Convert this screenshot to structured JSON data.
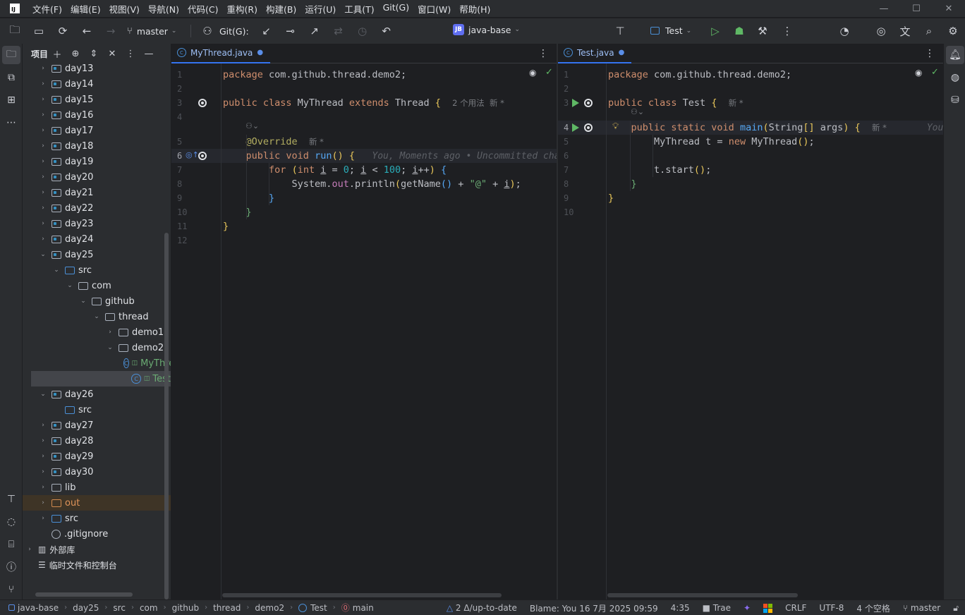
{
  "app": {
    "menu": [
      "文件(F)",
      "编辑(E)",
      "视图(V)",
      "导航(N)",
      "代码(C)",
      "重构(R)",
      "构建(B)",
      "运行(U)",
      "工具(T)",
      "Git(G)",
      "窗口(W)",
      "帮助(H)"
    ],
    "logo_text": "IJ"
  },
  "toolbar": {
    "branch": "master",
    "git_label": "Git(G):",
    "project_badge": "JB",
    "project_name": "java-base",
    "run_config": "Test"
  },
  "project_panel": {
    "title": "项目",
    "tree": [
      {
        "label": "day13",
        "level": 1,
        "kind": "module",
        "expanded": false
      },
      {
        "label": "day14",
        "level": 1,
        "kind": "module",
        "expanded": false
      },
      {
        "label": "day15",
        "level": 1,
        "kind": "module",
        "expanded": false
      },
      {
        "label": "day16",
        "level": 1,
        "kind": "module",
        "expanded": false
      },
      {
        "label": "day17",
        "level": 1,
        "kind": "module",
        "expanded": false
      },
      {
        "label": "day18",
        "level": 1,
        "kind": "module",
        "expanded": false
      },
      {
        "label": "day19",
        "level": 1,
        "kind": "module",
        "expanded": false
      },
      {
        "label": "day20",
        "level": 1,
        "kind": "module",
        "expanded": false
      },
      {
        "label": "day21",
        "level": 1,
        "kind": "module",
        "expanded": false
      },
      {
        "label": "day22",
        "level": 1,
        "kind": "module",
        "expanded": false
      },
      {
        "label": "day23",
        "level": 1,
        "kind": "module",
        "expanded": false
      },
      {
        "label": "day24",
        "level": 1,
        "kind": "module",
        "expanded": false
      },
      {
        "label": "day25",
        "level": 1,
        "kind": "module",
        "expanded": true
      },
      {
        "label": "src",
        "level": 2,
        "kind": "src",
        "expanded": true
      },
      {
        "label": "com",
        "level": 3,
        "kind": "folder",
        "expanded": true
      },
      {
        "label": "github",
        "level": 4,
        "kind": "folder",
        "expanded": true
      },
      {
        "label": "thread",
        "level": 5,
        "kind": "folder",
        "expanded": true
      },
      {
        "label": "demo1",
        "level": 6,
        "kind": "folder",
        "expanded": false
      },
      {
        "label": "demo2",
        "level": 6,
        "kind": "folder",
        "expanded": true
      },
      {
        "label": "MyThread",
        "level": 7,
        "kind": "class",
        "expanded": null
      },
      {
        "label": "Test",
        "level": 7,
        "kind": "class",
        "expanded": null,
        "selected": true
      },
      {
        "label": "day26",
        "level": 1,
        "kind": "module",
        "expanded": true
      },
      {
        "label": "src",
        "level": 2,
        "kind": "src",
        "expanded": null
      },
      {
        "label": "day27",
        "level": 1,
        "kind": "module",
        "expanded": false
      },
      {
        "label": "day28",
        "level": 1,
        "kind": "module",
        "expanded": false
      },
      {
        "label": "day29",
        "level": 1,
        "kind": "module",
        "expanded": false
      },
      {
        "label": "day30",
        "level": 1,
        "kind": "module",
        "expanded": false
      },
      {
        "label": "lib",
        "level": 1,
        "kind": "folder",
        "expanded": false
      },
      {
        "label": "out",
        "level": 1,
        "kind": "excluded",
        "expanded": false
      },
      {
        "label": "src",
        "level": 1,
        "kind": "src",
        "expanded": false
      },
      {
        "label": ".gitignore",
        "level": 1,
        "kind": "ignore",
        "expanded": null
      },
      {
        "label": "外部库",
        "level": 0,
        "kind": "lib",
        "expanded": false
      },
      {
        "label": "临时文件和控制台",
        "level": 0,
        "kind": "scratch",
        "expanded": null
      }
    ]
  },
  "editor_left": {
    "tab": "MyThread.java",
    "current_line": 6,
    "lines": [
      {
        "n": "1",
        "html": "<span class='kw'>package</span> com.github.thread.demo2;"
      },
      {
        "n": "2",
        "html": ""
      },
      {
        "n": "3",
        "html": "<span class='kw'>public class</span> MyThread <span class='kw'>extends</span> Thread <span class='brk'>{</span>  <span class='hint'>2 个用法  新 *</span>"
      },
      {
        "n": "4",
        "html": ""
      },
      {
        "n": "5",
        "html": "    <span class='ann'>@Override</span>  <span class='hint'>新 *</span>"
      },
      {
        "n": "6",
        "html": "    <span class='kw'>public void</span> <span class='fn'>run</span><span class='brk'>()</span> <span class='brk'>{</span>   <span class='inlay'>You, Moments ago • Uncommitted changes</span>"
      },
      {
        "n": "7",
        "html": "        <span class='kw'>for</span> <span class='brk'>(</span><span class='kw'>int</span> <u>i</u> = <span class='num'>0</span>; <u>i</u> &lt; <span class='num'>100</span>; <u>i</u>++<span class='brk'>)</span> <span class='fn'>{</span>"
      },
      {
        "n": "8",
        "html": "            System.<span class='field'>out</span>.println<span class='brk'>(</span>getName<span class='fn'>()</span> + <span class='str'>\"@\"</span> + <u>i</u><span class='brk'>)</span>;"
      },
      {
        "n": "9",
        "html": "        <span class='fn'>}</span>"
      },
      {
        "n": "10",
        "html": "    <span class='str'>}</span>"
      },
      {
        "n": "11",
        "html": "<span class='brk'>}</span>"
      },
      {
        "n": "12",
        "html": ""
      }
    ]
  },
  "editor_right": {
    "tab": "Test.java",
    "current_line": 4,
    "lines": [
      {
        "n": "1",
        "html": "<span class='kw'>package</span> com.github.thread.demo2;"
      },
      {
        "n": "2",
        "html": ""
      },
      {
        "n": "3",
        "html": "<span class='kw'>public class</span> Test <span class='brk'>{</span>  <span class='hint'>新 *</span>"
      },
      {
        "n": "4",
        "html": "    <span class='kw'>public static void</span> <span class='fn'>main</span><span class='brk'>(</span>String<span class='brk'>[]</span> args<span class='brk'>)</span> <span class='brk'>{</span>  <span class='hint'>新 *</span>       <span class='inlay'>You</span>"
      },
      {
        "n": "5",
        "html": "        MyThread t = <span class='kw'>new</span> MyThread<span class='brk'>()</span>;"
      },
      {
        "n": "6",
        "html": ""
      },
      {
        "n": "7",
        "html": "        t.start<span class='brk'>()</span>;"
      },
      {
        "n": "8",
        "html": "    <span class='str'>}</span>"
      },
      {
        "n": "9",
        "html": "<span class='brk'>}</span>"
      },
      {
        "n": "10",
        "html": ""
      }
    ]
  },
  "statusbar": {
    "crumbs": [
      "java-base",
      "day25",
      "src",
      "com",
      "github",
      "thread",
      "demo2",
      "Test",
      "main"
    ],
    "git_status": "2 Δ/up-to-date",
    "blame": "Blame: You 16 7月 2025 09:59",
    "position": "4:35",
    "trae": "Trae",
    "line_ending": "CRLF",
    "encoding": "UTF-8",
    "indent": "4 个空格",
    "branch": "master"
  }
}
